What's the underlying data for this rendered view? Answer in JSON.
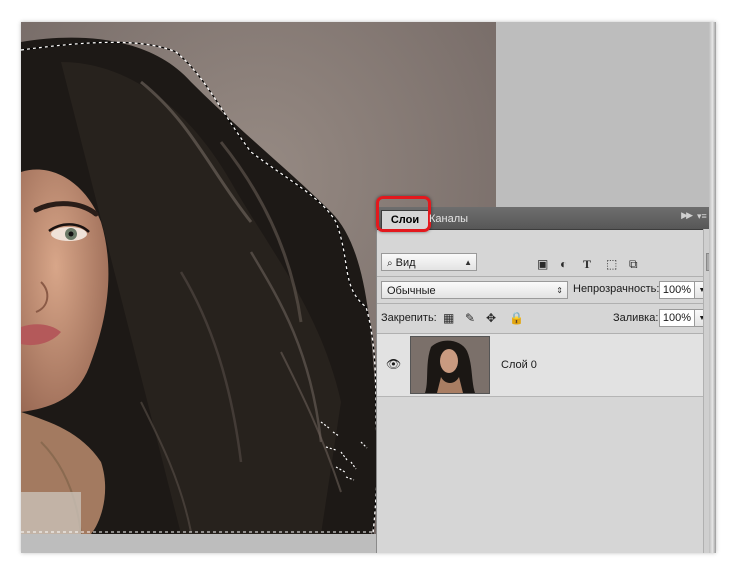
{
  "panel": {
    "tabs": [
      {
        "label": "Слои",
        "active": true
      },
      {
        "label": "Каналы",
        "active": false
      }
    ],
    "collapse_icon": "double-chevron-right-icon",
    "menu_icon": "panel-menu-icon",
    "filter": {
      "kind_label": "Вид",
      "icons": [
        "image-filter-icon",
        "adjustment-filter-icon",
        "type-filter-icon",
        "shape-filter-icon",
        "smart-object-filter-icon"
      ]
    },
    "blend_mode": "Обычные",
    "opacity_label": "Непрозрачность:",
    "opacity_value": "100%",
    "lock_label": "Закрепить:",
    "lock_icons": [
      "lock-transparent-icon",
      "lock-image-icon",
      "lock-position-icon",
      "lock-all-icon"
    ],
    "fill_label": "Заливка:",
    "fill_value": "100%",
    "layers": [
      {
        "name": "Слой 0",
        "visible": true
      }
    ]
  },
  "colors": {
    "highlight": "#e3181d",
    "panel_bg": "#d6d6d6",
    "tabbar_bg": "#5f5f5f",
    "canvas_bg": "#8a7d76"
  }
}
